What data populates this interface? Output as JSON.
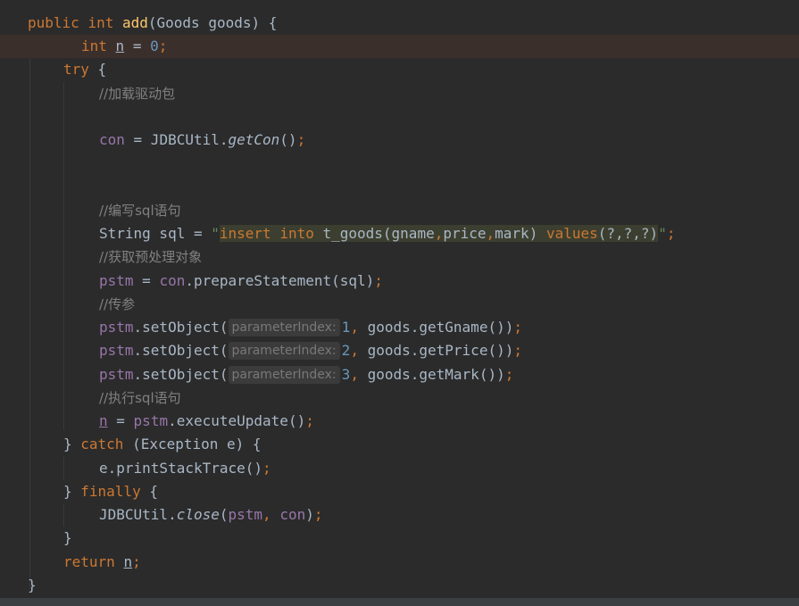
{
  "code": {
    "sig_public": "public",
    "sig_int": "int",
    "sig_method": "add",
    "sig_rest": "(Goods goods) {",
    "decl_int": "int",
    "decl_var": "n",
    "decl_eq": " = ",
    "decl_val": "0",
    "decl_semi": ";",
    "try_kw": "try",
    "try_brace": " {",
    "cmt_load_driver": "//加载驱动包",
    "con_var": "con",
    "con_assign": " = JDBCUtil.",
    "con_method": "getCon",
    "con_call": "()",
    "semi": ";",
    "cmt_write_sql": "//编写sql语句",
    "sql_decl": "String sql = ",
    "quote": "\"",
    "sql_insert": "insert",
    "sql_into": "into",
    "sql_table": " t_goods(gname",
    "sql_comma": ",",
    "sql_price": "price",
    "sql_mark": "mark) ",
    "sql_values": "values",
    "sql_params": "(?,?,?)",
    "cmt_get_stmt": "//获取预处理对象",
    "pstm_var": "pstm",
    "pstm_assign_prefix": " = ",
    "pstm_assign_call": ".prepareStatement(sql)",
    "cmt_pass_params": "//传参",
    "setobj_call": ".setObject(",
    "hint_label": "parameterIndex:",
    "set_rows": [
      {
        "index": "1",
        "arg": " goods.getGname())"
      },
      {
        "index": "2",
        "arg": " goods.getPrice())"
      },
      {
        "index": "3",
        "arg": " goods.getMark())"
      }
    ],
    "comma": ",",
    "cmt_exec_sql": "//执行sql语句",
    "exec_var": "n",
    "exec_eq": " = ",
    "exec_call": ".executeUpdate()",
    "catch_open": "} ",
    "catch_kw": "catch",
    "catch_rest": " (Exception e) {",
    "print_trace": "e.printStackTrace()",
    "finally_open": "} ",
    "finally_kw": "finally",
    "finally_brace": " {",
    "close_prefix": "JDBCUtil.",
    "close_method": "close",
    "close_paren": "(",
    "close_pstm": "pstm",
    "close_comma": ", ",
    "close_con": "con",
    "close_end": ")",
    "brace_close": "}",
    "return_kw": "return",
    "return_space": " ",
    "return_var": "n"
  },
  "colors": {
    "background": "#2b2b2b",
    "keyword": "#cc7832",
    "method_decl": "#ffc66d",
    "field": "#9876aa",
    "number": "#6897bb",
    "string": "#6a8759",
    "comment": "#808080",
    "highlight_line": "#3b2f2c"
  }
}
